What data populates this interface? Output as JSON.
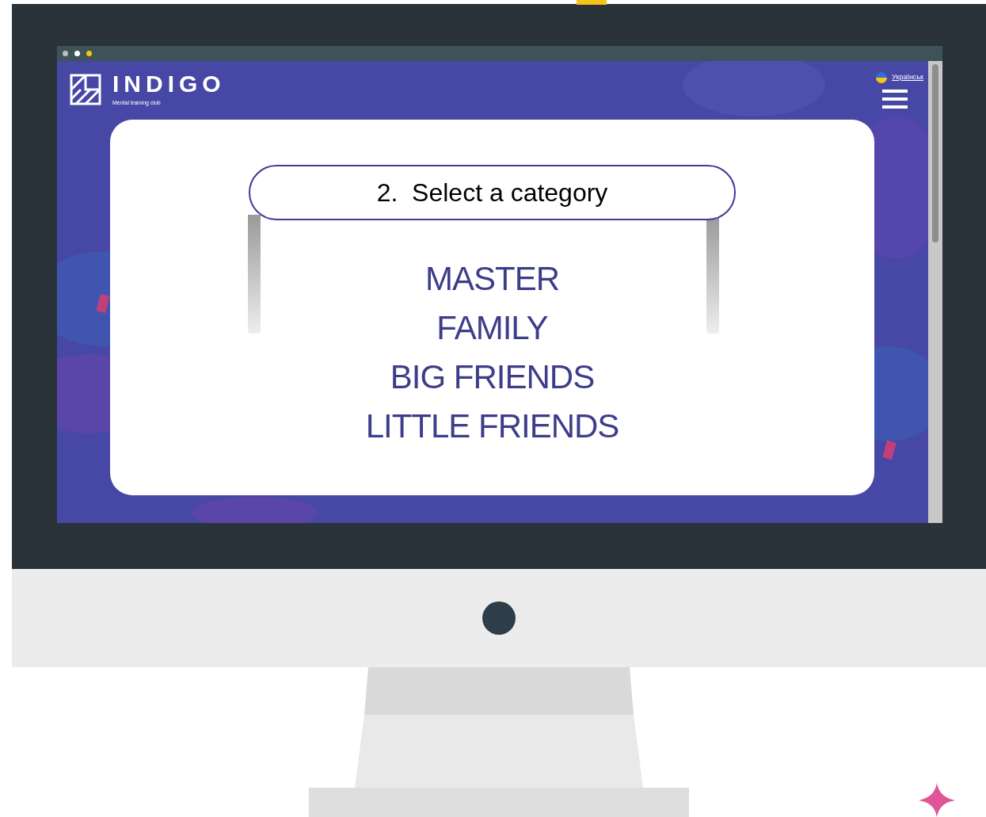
{
  "browser": {
    "dots": [
      {
        "color": "#bfbfbf"
      },
      {
        "color": "#ffffff"
      },
      {
        "color": "#f5c518"
      }
    ]
  },
  "header": {
    "logo": "INDIGO",
    "tagline": "Mental training club",
    "language": "Українськ"
  },
  "card": {
    "title": "2.  Select a category",
    "categories": [
      "MASTER",
      "FAMILY",
      "BIG FRIENDS",
      "LITTLE FRIENDS"
    ]
  }
}
